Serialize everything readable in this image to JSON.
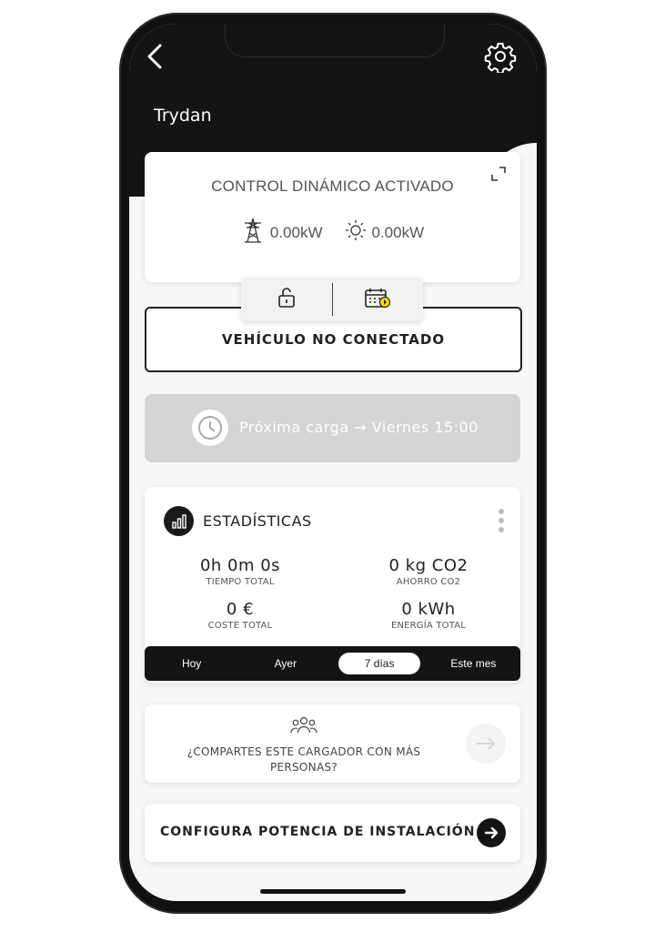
{
  "header": {
    "title": "Trydan"
  },
  "control": {
    "title": "CONTROL DINÁMICO ACTIVADO",
    "grid_power": "0.00kW",
    "solar_power": "0.00kW"
  },
  "vehicle": {
    "status": "VEHÍCULO NO CONECTADO"
  },
  "schedule": {
    "next_charge": "Próxima carga → Viernes 15:00"
  },
  "stats": {
    "title": "ESTADÍSTICAS",
    "total_time": {
      "value": "0h 0m 0s",
      "label": "TIEMPO TOTAL"
    },
    "co2_saving": {
      "value": "0 kg CO2",
      "label": "AHORRO CO2"
    },
    "total_cost": {
      "value": "0 €",
      "label": "COSTE TOTAL"
    },
    "total_energy": {
      "value": "0 kWh",
      "label": "ENERGÍA TOTAL"
    },
    "periods": [
      "Hoy",
      "Ayer",
      "7 días",
      "Este mes"
    ],
    "active_period": "7 días"
  },
  "share": {
    "text": "¿COMPARTES ESTE CARGADOR CON MÁS PERSONAS?"
  },
  "config": {
    "text": "CONFIGURA POTENCIA DE INSTALACIÓN"
  },
  "colors": {
    "header": "#141414",
    "accent": "#f5e000",
    "disabled_card": "#d4d4d4"
  }
}
